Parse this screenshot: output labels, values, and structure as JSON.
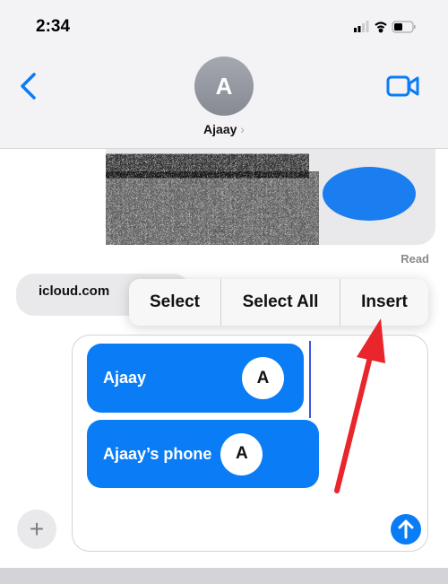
{
  "status_bar": {
    "time": "2:34"
  },
  "header": {
    "contact_initial": "A",
    "contact_name": "Ajaay",
    "chevron": "›"
  },
  "messages": {
    "read_receipt": "Read",
    "received_text": "icloud.com"
  },
  "context_menu": {
    "items": [
      "Select",
      "Select All",
      "Insert"
    ]
  },
  "compose": {
    "chips": [
      {
        "label": "Ajaay",
        "initial": "A"
      },
      {
        "label": "Ajaay’s phone",
        "initial": "A"
      }
    ],
    "plus_label": "+"
  },
  "colors": {
    "accent": "#0a7cf5",
    "annotation_arrow": "#e8262b"
  }
}
